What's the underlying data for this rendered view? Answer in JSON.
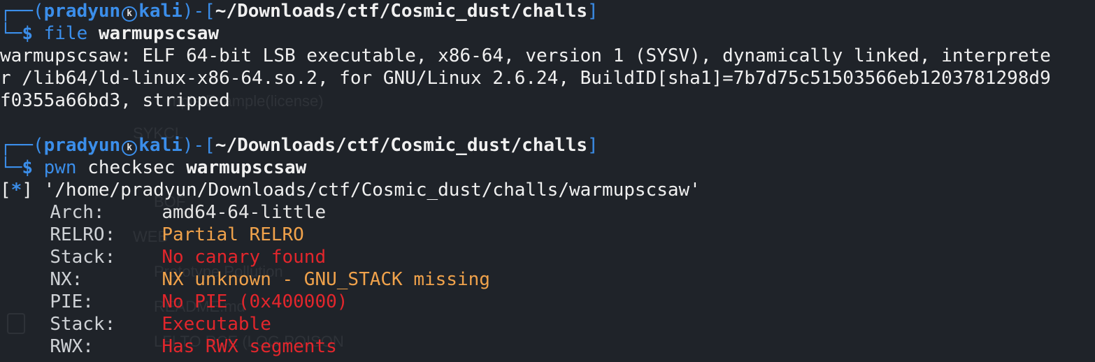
{
  "ghost": {
    "line1": "mple Example(license)",
    "line2": "SYKCL",
    "line3": "BOF",
    "line4": "WEB",
    "line5": "Prototype Pollution",
    "line6": "README.md",
    "line7": "LFI TO RCE (LOG POISON"
  },
  "prompt1": {
    "user": "pradyun",
    "icon": "kali-dragon-icon",
    "host": "kali",
    "path": "~/Downloads/ctf/Cosmic_dust/challs",
    "command": "file",
    "arg": "warmupscsaw"
  },
  "file_output": [
    "warmupscsaw: ELF 64-bit LSB executable, x86-64, version 1 (SYSV), dynamically linked, interprete",
    "r /lib64/ld-linux-x86-64.so.2, for GNU/Linux 2.6.24, BuildID[sha1]=7b7d75c51503566eb1203781298d9",
    "f0355a66bd3, stripped"
  ],
  "prompt2": {
    "user": "pradyun",
    "host": "kali",
    "path": "~/Downloads/ctf/Cosmic_dust/challs",
    "command_part1": "pwn",
    "command_part2": "checksec",
    "arg": "warmupscsaw"
  },
  "checksec": {
    "info_mark": "*",
    "file_path": "'/home/pradyun/Downloads/ctf/Cosmic_dust/challs/warmupscsaw'",
    "rows": [
      {
        "key": "Arch:",
        "value": "amd64-64-little",
        "color": "#e6e6e6"
      },
      {
        "key": "RELRO:",
        "value": "Partial RELRO",
        "color": "#f0a24b"
      },
      {
        "key": "Stack:",
        "value": "No canary found",
        "color": "#e3262c"
      },
      {
        "key": "NX:",
        "value": "NX unknown - GNU_STACK missing",
        "color": "#f0a24b"
      },
      {
        "key": "PIE:",
        "value": "No PIE (0x400000)",
        "color": "#e3262c"
      },
      {
        "key": "Stack:",
        "value": "Executable",
        "color": "#e3262c"
      },
      {
        "key": "RWX:",
        "value": "Has RWX segments",
        "color": "#e3262c"
      }
    ]
  },
  "colors": {
    "background": "#1f2329",
    "prompt_blue": "#3b8eea",
    "warn_orange": "#f0a24b",
    "bad_red": "#e3262c"
  }
}
